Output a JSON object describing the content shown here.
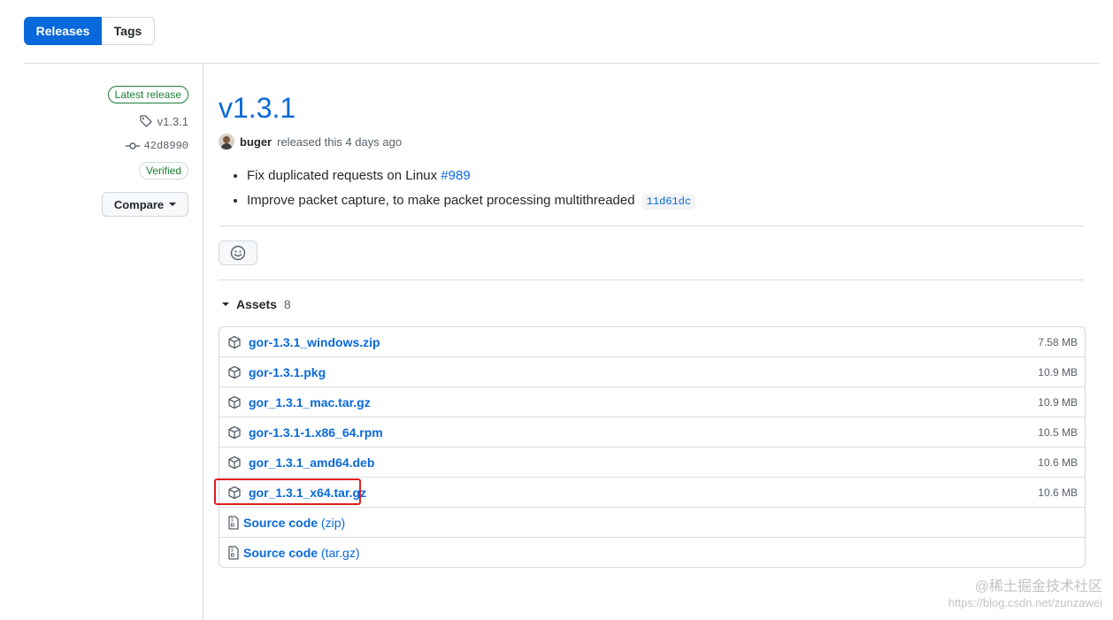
{
  "tabs": {
    "releases": "Releases",
    "tags": "Tags"
  },
  "sidebar": {
    "latest_badge": "Latest release",
    "tag": "v1.3.1",
    "commit": "42d8990",
    "verified": "Verified",
    "compare": "Compare"
  },
  "release": {
    "title": "v1.3.1",
    "author": "buger",
    "released_text": "released this 4 days ago",
    "notes": [
      {
        "text": "Fix duplicated requests on Linux ",
        "link": "#989"
      },
      {
        "text": "Improve packet capture, to make packet processing multithreaded",
        "sha": "11d61dc"
      }
    ]
  },
  "assets": {
    "title": "Assets",
    "count": "8",
    "items": [
      {
        "name": "gor-1.3.1_windows.zip",
        "size": "7.58 MB"
      },
      {
        "name": "gor-1.3.1.pkg",
        "size": "10.9 MB"
      },
      {
        "name": "gor_1.3.1_mac.tar.gz",
        "size": "10.9 MB"
      },
      {
        "name": "gor-1.3.1-1.x86_64.rpm",
        "size": "10.5 MB"
      },
      {
        "name": "gor_1.3.1_amd64.deb",
        "size": "10.6 MB"
      },
      {
        "name": "gor_1.3.1_x64.tar.gz",
        "size": "10.6 MB"
      }
    ],
    "source": [
      {
        "label": "Source code",
        "kind": "(zip)"
      },
      {
        "label": "Source code",
        "kind": "(tar.gz)"
      }
    ]
  },
  "watermark": {
    "text": "@稀土掘金技术社区",
    "url": "https://blog.csdn.net/zunzawei"
  },
  "colors": {
    "accent": "#0969da",
    "success": "#1a7f37",
    "highlight": "#e02020"
  }
}
